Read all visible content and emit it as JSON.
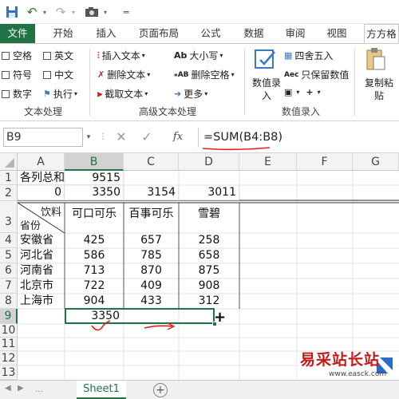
{
  "quick_access": {
    "save_icon": "save-icon",
    "undo_icon": "undo-icon",
    "redo_icon": "redo-icon",
    "camera_icon": "camera-icon",
    "customize_icon": "customize-icon"
  },
  "tabs": [
    "文件",
    "开始",
    "插入",
    "页面布局",
    "公式",
    "数据",
    "审阅",
    "视图",
    "方方格"
  ],
  "ribbon": {
    "text_process": {
      "items": [
        "空格",
        "英文",
        "符号",
        "中文",
        "数字",
        "执行"
      ],
      "group_label": "文本处理"
    },
    "advanced_text": {
      "items": [
        "插入文本",
        "删除文本",
        "截取文本",
        "大小写",
        "删除空格",
        "更多"
      ],
      "group_label": "高级文本处理"
    },
    "number_entry": {
      "value_entry_label": "数值录",
      "value_entry_label2": "入",
      "round_label": "四舍五入",
      "keep_value_label": "只保留数值",
      "group_label": "数值录入"
    },
    "paste": {
      "label": "复制粘",
      "label2": "贴"
    }
  },
  "formula_bar": {
    "name_box": "B9",
    "cancel_symbol": "✕",
    "confirm_symbol": "✓",
    "fx_symbol": "fx",
    "formula": "=SUM(B4:B8)"
  },
  "columns": [
    "A",
    "B",
    "C",
    "D",
    "E",
    "F",
    "G"
  ],
  "rows": [
    "1",
    "2",
    "3",
    "4",
    "5",
    "6",
    "7",
    "8",
    "9",
    "10",
    "11",
    "12",
    "13"
  ],
  "cells": {
    "a1": "各列总和",
    "b1": "9515",
    "a2": "0",
    "b2": "3350",
    "c2": "3154",
    "d2": "3011",
    "a3_top": "饮料",
    "a3_bottom": "省份",
    "b3": "可口可乐",
    "c3": "百事可乐",
    "d3": "雪碧",
    "data_rows": [
      {
        "province": "安徽省",
        "b": "425",
        "c": "657",
        "d": "258"
      },
      {
        "province": "河北省",
        "b": "586",
        "c": "785",
        "d": "658"
      },
      {
        "province": "河南省",
        "b": "713",
        "c": "870",
        "d": "875"
      },
      {
        "province": "北京市",
        "b": "722",
        "c": "409",
        "d": "908"
      },
      {
        "province": "上海市",
        "b": "904",
        "c": "433",
        "d": "312"
      }
    ],
    "b9": "3350"
  },
  "sheets": {
    "active": "Sheet1",
    "add_symbol": "+"
  },
  "watermark": {
    "title": "易采站长站",
    "url": "www.easck.com"
  },
  "colors": {
    "excel_green": "#217346",
    "annotation_red": "#e02020"
  }
}
